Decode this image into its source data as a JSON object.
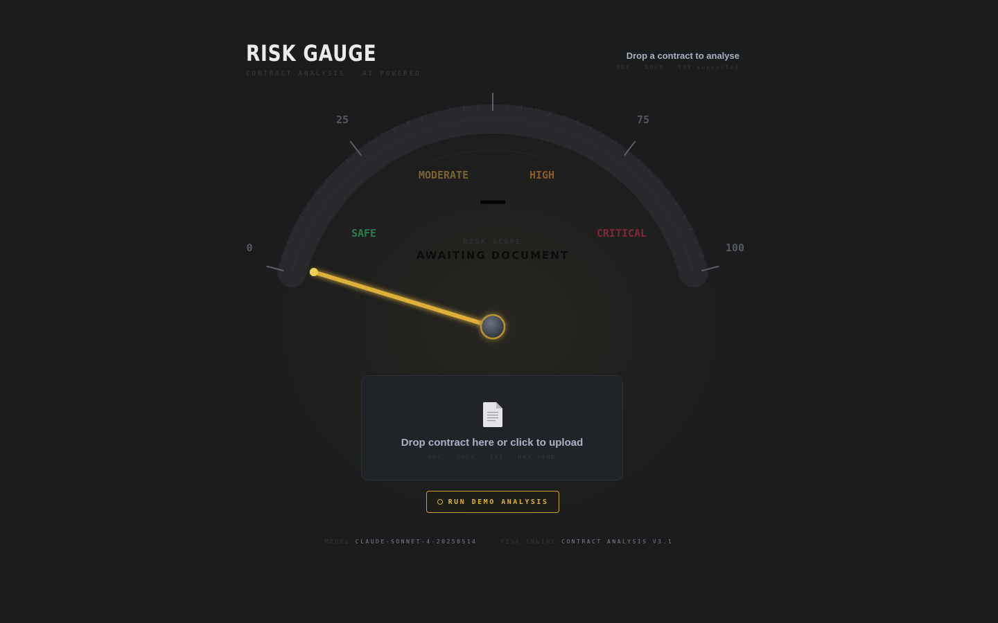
{
  "header": {
    "title": "RISK GAUGE",
    "subtitle": "CONTRACT ANALYSIS · AI POWERED",
    "drop_hint": "Drop a contract to analyse",
    "drop_formats": "PDF · DOCX · TXT supported"
  },
  "gauge": {
    "ticks": [
      "0",
      "25",
      "75",
      "100"
    ],
    "zones": [
      "SAFE",
      "MODERATE",
      "HIGH",
      "CRITICAL"
    ],
    "score_display": "—",
    "score_label": "RISK SCORE",
    "status": "AWAITING DOCUMENT",
    "needle_value": 0,
    "colors": {
      "safe": "#2f7d4f",
      "moderate": "#7a6330",
      "high": "#8a5a2a",
      "critical": "#7d2a36",
      "needle": "#e8b83e"
    }
  },
  "upload": {
    "icon": "document-icon",
    "label": "Drop contract here or click to upload",
    "formats": "PDF · DOCX · TXT · MAX 50MB"
  },
  "demo": {
    "icon": "circle-icon",
    "label": "RUN DEMO ANALYSIS"
  },
  "footer": {
    "model_key": "MODEL",
    "model_value": "CLAUDE-SONNET-4-20250514",
    "engine_key": "RISK ENGINE",
    "engine_value": "CONTRACT ANALYSIS V3.1"
  }
}
